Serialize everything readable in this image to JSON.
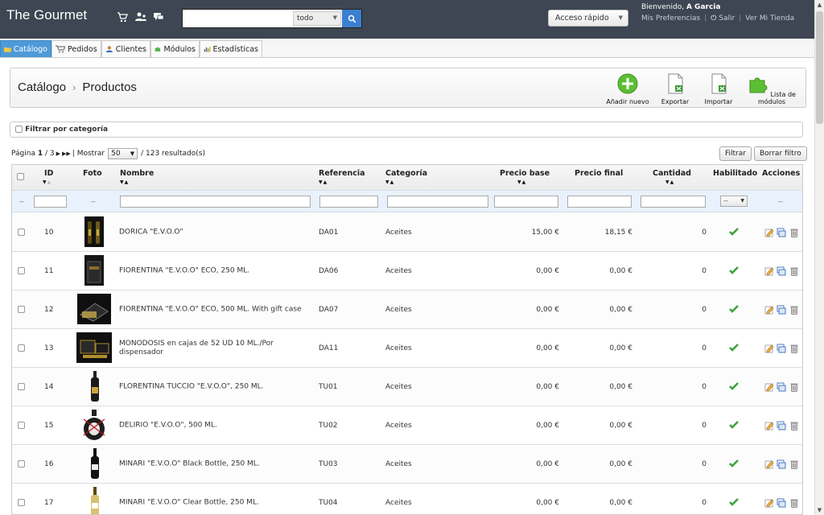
{
  "header": {
    "brand": "The Gourmet",
    "search_placeholder": "",
    "search_scope": "todo",
    "quick_access": "Acceso rápido",
    "welcome_prefix": "Bienvenido,",
    "user_name": "A Garcia",
    "links": {
      "preferences": "Mis Preferencias",
      "logout": "Salir",
      "view_store": "Ver Mi Tienda"
    }
  },
  "tabs": [
    {
      "label": "Catálogo",
      "active": true
    },
    {
      "label": "Pedidos"
    },
    {
      "label": "Clientes"
    },
    {
      "label": "Módulos"
    },
    {
      "label": "Estadísticas"
    }
  ],
  "breadcrumb": {
    "root": "Catálogo",
    "current": "Productos"
  },
  "toolbar": {
    "add_new": "Añadir nuevo",
    "export": "Exportar",
    "import": "Importar",
    "modules_list": "Lista de módulos"
  },
  "category_filter": {
    "label": "Filtrar por categoría"
  },
  "pagination": {
    "page_label": "Página",
    "current_page": "1",
    "total_pages": "/ 3",
    "show_label": "| Mostrar",
    "per_page": "50",
    "results": "/ 123 resultado(s)"
  },
  "buttons": {
    "filter": "Filtrar",
    "clear_filter": "Borrar filtro"
  },
  "table": {
    "columns": {
      "id": "ID",
      "photo": "Foto",
      "name": "Nombre",
      "reference": "Referencia",
      "category": "Categoría",
      "base_price": "Precio base",
      "final_price": "Precio final",
      "quantity": "Cantidad",
      "enabled": "Habilitado",
      "actions": "Acciones"
    },
    "filter_placeholder": "--",
    "rows": [
      {
        "id": "10",
        "name": "DORICA \"E.V.O.O\"",
        "reference": "DA01",
        "category": "Aceites",
        "base_price": "15,00 €",
        "final_price": "18,15 €",
        "quantity": "0"
      },
      {
        "id": "11",
        "name": "FIORENTINA \"E.V.O.O\" ECO, 250 ML.",
        "reference": "DA06",
        "category": "Aceites",
        "base_price": "0,00 €",
        "final_price": "0,00 €",
        "quantity": "0"
      },
      {
        "id": "12",
        "name": "FIORENTINA \"E.V.O.O\" ECO, 500 ML. With gift case",
        "reference": "DA07",
        "category": "Aceites",
        "base_price": "0,00 €",
        "final_price": "0,00 €",
        "quantity": "0"
      },
      {
        "id": "13",
        "name": "MONODOSIS en cajas de 52 UD 10 ML./Por dispensador",
        "reference": "DA11",
        "category": "Aceites",
        "base_price": "0,00 €",
        "final_price": "0,00 €",
        "quantity": "0"
      },
      {
        "id": "14",
        "name": "FLORENTINA TUCCIO \"E.V.O.O\", 250 ML.",
        "reference": "TU01",
        "category": "Aceites",
        "base_price": "0,00 €",
        "final_price": "0,00 €",
        "quantity": "0"
      },
      {
        "id": "15",
        "name": "DELIRIO \"E.V.O.O\", 500 ML.",
        "reference": "TU02",
        "category": "Aceites",
        "base_price": "0,00 €",
        "final_price": "0,00 €",
        "quantity": "0"
      },
      {
        "id": "16",
        "name": "MINARI \"E.V.O.O\" Black Bottle, 250 ML.",
        "reference": "TU03",
        "category": "Aceites",
        "base_price": "0,00 €",
        "final_price": "0,00 €",
        "quantity": "0"
      },
      {
        "id": "17",
        "name": "MINARI \"E.V.O.O\" Clear Bottle, 250 ML.",
        "reference": "TU04",
        "category": "Aceites",
        "base_price": "0,00 €",
        "final_price": "0,00 €",
        "quantity": "0"
      }
    ]
  },
  "colors": {
    "header_bg": "#3d4652",
    "active_tab": "#4e9ad8",
    "search_button": "#3b7fcf",
    "enabled_check": "#3fa33f",
    "filter_row": "#e9f2fc"
  }
}
